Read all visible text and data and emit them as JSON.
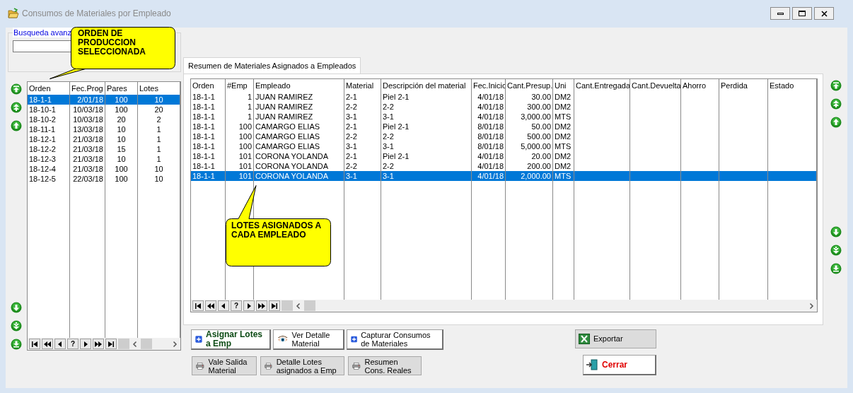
{
  "window": {
    "title": "Consumos de Materiales por Empleado"
  },
  "search": {
    "label": "Busqueda avanz"
  },
  "orders_table": {
    "columns": [
      "Orden",
      "Fec.Prog",
      "Pares",
      "Lotes"
    ],
    "rows": [
      {
        "cells": [
          "18-1-1",
          "2/01/18",
          "100",
          "10"
        ],
        "selected": true
      },
      {
        "cells": [
          "18-10-1",
          "10/03/18",
          "100",
          "20"
        ],
        "selected": false
      },
      {
        "cells": [
          "18-10-2",
          "10/03/18",
          "20",
          "2"
        ],
        "selected": false
      },
      {
        "cells": [
          "18-11-1",
          "13/03/18",
          "10",
          "1"
        ],
        "selected": false
      },
      {
        "cells": [
          "18-12-1",
          "21/03/18",
          "10",
          "1"
        ],
        "selected": false
      },
      {
        "cells": [
          "18-12-2",
          "21/03/18",
          "15",
          "1"
        ],
        "selected": false
      },
      {
        "cells": [
          "18-12-3",
          "21/03/18",
          "10",
          "1"
        ],
        "selected": false
      },
      {
        "cells": [
          "18-12-4",
          "21/03/18",
          "100",
          "10"
        ],
        "selected": false
      },
      {
        "cells": [
          "18-12-5",
          "22/03/18",
          "100",
          "10"
        ],
        "selected": false
      }
    ]
  },
  "tabs": [
    {
      "label": "Resumen de Materiales Asignados a Empleados",
      "selected": true
    }
  ],
  "materials_table": {
    "columns": [
      "Orden",
      "#Emp",
      "Empleado",
      "Material",
      "Descripción del material",
      "Fec.Inicic",
      "Cant.Presup.",
      "Uni",
      "Cant.Entregada",
      "Cant.Devuelta",
      "Ahorro",
      "Perdida",
      "Estado"
    ],
    "rows": [
      {
        "cells": [
          "18-1-1",
          "1",
          "JUAN RAMIREZ",
          "2-1",
          "Piel 2-1",
          "4/01/18",
          "30.00",
          "DM2"
        ],
        "selected": false
      },
      {
        "cells": [
          "18-1-1",
          "1",
          "JUAN RAMIREZ",
          "2-2",
          "2-2",
          "4/01/18",
          "300.00",
          "DM2"
        ],
        "selected": false
      },
      {
        "cells": [
          "18-1-1",
          "1",
          "JUAN RAMIREZ",
          "3-1",
          "3-1",
          "4/01/18",
          "3,000.00",
          "MTS"
        ],
        "selected": false
      },
      {
        "cells": [
          "18-1-1",
          "100",
          "CAMARGO ELIAS",
          "2-1",
          "Piel 2-1",
          "8/01/18",
          "50.00",
          "DM2"
        ],
        "selected": false
      },
      {
        "cells": [
          "18-1-1",
          "100",
          "CAMARGO ELIAS",
          "2-2",
          "2-2",
          "8/01/18",
          "500.00",
          "DM2"
        ],
        "selected": false
      },
      {
        "cells": [
          "18-1-1",
          "100",
          "CAMARGO ELIAS",
          "3-1",
          "3-1",
          "8/01/18",
          "5,000.00",
          "MTS"
        ],
        "selected": false
      },
      {
        "cells": [
          "18-1-1",
          "101",
          "CORONA YOLANDA",
          "2-1",
          "Piel 2-1",
          "4/01/18",
          "20.00",
          "DM2"
        ],
        "selected": false
      },
      {
        "cells": [
          "18-1-1",
          "101",
          "CORONA YOLANDA",
          "2-2",
          "2-2",
          "4/01/18",
          "200.00",
          "DM2"
        ],
        "selected": false
      },
      {
        "cells": [
          "18-1-1",
          "101",
          "CORONA YOLANDA",
          "3-1",
          "3-1",
          "4/01/18",
          "2,000.00",
          "MTS"
        ],
        "selected": true
      }
    ]
  },
  "navigator": {
    "help": "?"
  },
  "action_buttons": [
    {
      "label": "Asignar Lotes a Emp",
      "kind": "add",
      "bold": true
    },
    {
      "label": "Ver Detalle Material",
      "kind": "eye",
      "bold": false
    },
    {
      "label": "Capturar Consumos de Materiales",
      "kind": "add",
      "bold": false
    }
  ],
  "print_buttons": [
    {
      "label": "Vale Salida Material"
    },
    {
      "label": "Detalle Lotes asignados a Emp"
    },
    {
      "label": "Resumen Cons. Reales"
    }
  ],
  "export_button": {
    "label": "Exportar"
  },
  "close_button": {
    "label": "Cerrar"
  },
  "callouts": [
    {
      "text": "ORDEN DE PRODUCCION SELECCIONADA"
    },
    {
      "text": "LOTES ASIGNADOS A CADA EMPLEADO"
    }
  ]
}
